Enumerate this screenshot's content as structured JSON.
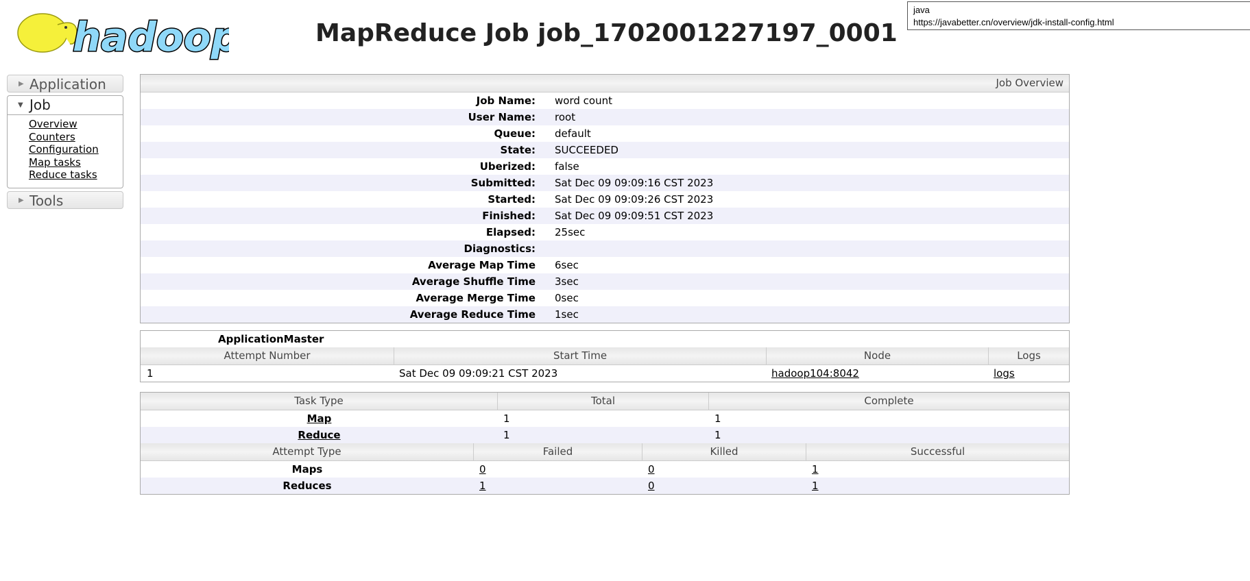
{
  "header": {
    "title": "MapReduce Job job_1702001227197_0001",
    "logo_text": "hadoop"
  },
  "tooltip": {
    "line1": "java",
    "line2": "https://javabetter.cn/overview/jdk-install-config.html"
  },
  "sidebar": {
    "application": "Application",
    "job": "Job",
    "job_links": [
      "Overview",
      "Counters",
      "Configuration",
      "Map tasks",
      "Reduce tasks"
    ],
    "tools": "Tools"
  },
  "overview": {
    "title": "Job Overview",
    "rows": [
      {
        "label": "Job Name:",
        "value": "word count"
      },
      {
        "label": "User Name:",
        "value": "root"
      },
      {
        "label": "Queue:",
        "value": "default"
      },
      {
        "label": "State:",
        "value": "SUCCEEDED"
      },
      {
        "label": "Uberized:",
        "value": "false"
      },
      {
        "label": "Submitted:",
        "value": "Sat Dec 09 09:09:16 CST 2023"
      },
      {
        "label": "Started:",
        "value": "Sat Dec 09 09:09:26 CST 2023"
      },
      {
        "label": "Finished:",
        "value": "Sat Dec 09 09:09:51 CST 2023"
      },
      {
        "label": "Elapsed:",
        "value": "25sec"
      },
      {
        "label": "Diagnostics:",
        "value": ""
      },
      {
        "label": "Average Map Time",
        "value": "6sec"
      },
      {
        "label": "Average Shuffle Time",
        "value": "3sec"
      },
      {
        "label": "Average Merge Time",
        "value": "0sec"
      },
      {
        "label": "Average Reduce Time",
        "value": "1sec"
      }
    ]
  },
  "am": {
    "title": "ApplicationMaster",
    "headers": [
      "Attempt Number",
      "Start Time",
      "Node",
      "Logs"
    ],
    "row": [
      "1",
      "Sat Dec 09 09:09:21 CST 2023",
      "hadoop104:8042",
      "logs"
    ]
  },
  "tasks": {
    "headers": [
      "Task Type",
      "Total",
      "Complete"
    ],
    "rows": [
      [
        "Map",
        "1",
        "1"
      ],
      [
        "Reduce",
        "1",
        "1"
      ]
    ],
    "attempt_headers": [
      "Attempt Type",
      "Failed",
      "Killed",
      "Successful"
    ],
    "attempt_rows": [
      [
        "Maps",
        "0",
        "0",
        "1"
      ],
      [
        "Reduces",
        "1",
        "0",
        "1"
      ]
    ]
  }
}
